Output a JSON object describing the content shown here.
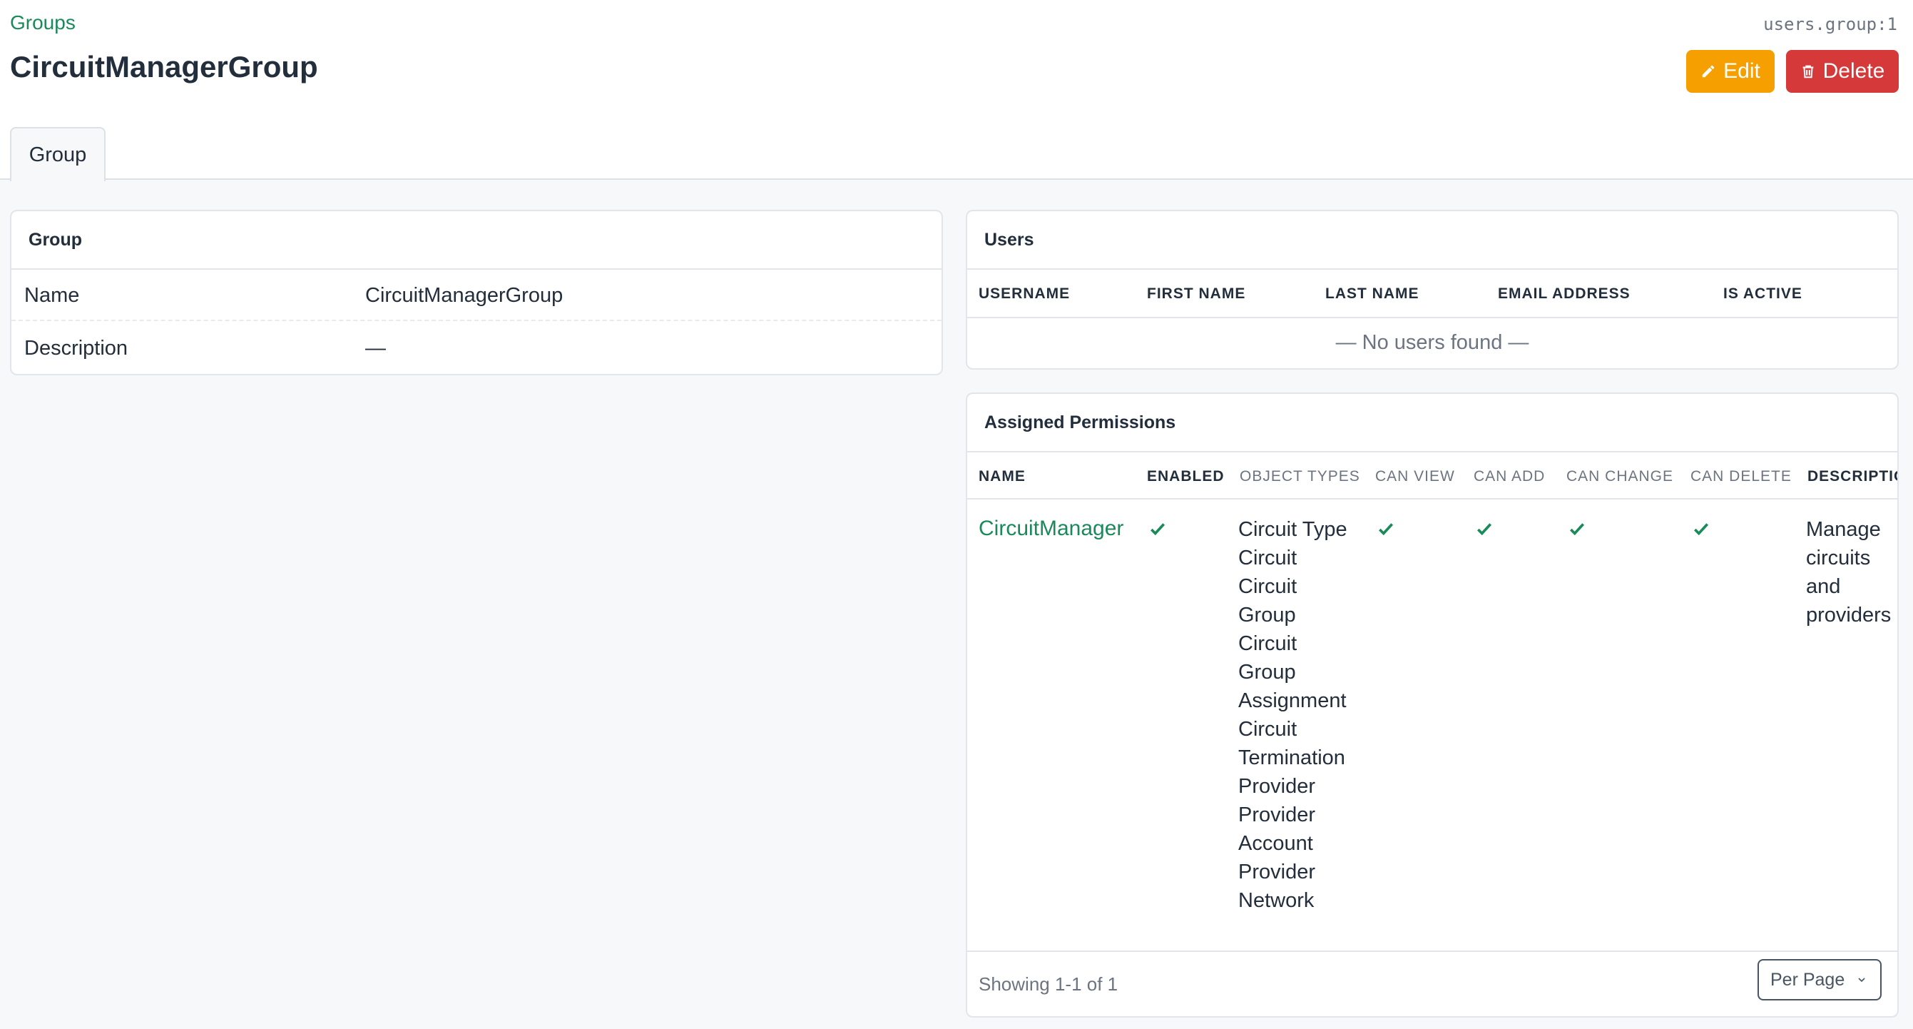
{
  "breadcrumb": "Groups",
  "object_id": "users.group:1",
  "title": "CircuitManagerGroup",
  "buttons": {
    "edit": "Edit",
    "delete": "Delete"
  },
  "tab": "Group",
  "group_card": {
    "header": "Group",
    "rows": [
      {
        "label": "Name",
        "value": "CircuitManagerGroup"
      },
      {
        "label": "Description",
        "value": "—"
      }
    ]
  },
  "users_card": {
    "header": "Users",
    "columns": [
      "USERNAME",
      "FIRST NAME",
      "LAST NAME",
      "EMAIL ADDRESS",
      "IS ACTIVE"
    ],
    "empty": "— No users found —"
  },
  "perms_card": {
    "header": "Assigned Permissions",
    "columns": [
      "NAME",
      "ENABLED",
      "OBJECT TYPES",
      "CAN VIEW",
      "CAN ADD",
      "CAN CHANGE",
      "CAN DELETE",
      "DESCRIPTIO"
    ],
    "row": {
      "name": "CircuitManager",
      "enabled": true,
      "object_types": [
        "Circuit Type",
        "Circuit",
        "Circuit Group",
        "Circuit Group Assignment",
        "Circuit Termination",
        "Provider",
        "Provider Account",
        "Provider Network"
      ],
      "can_view": true,
      "can_add": true,
      "can_change": true,
      "can_delete": true,
      "description": "Manage circuits and providers"
    },
    "showing": "Showing 1-1 of 1",
    "per_page": "Per Page"
  },
  "colors": {
    "accent": "#1a8a5a",
    "edit": "#f59f00",
    "delete": "#d63939"
  }
}
